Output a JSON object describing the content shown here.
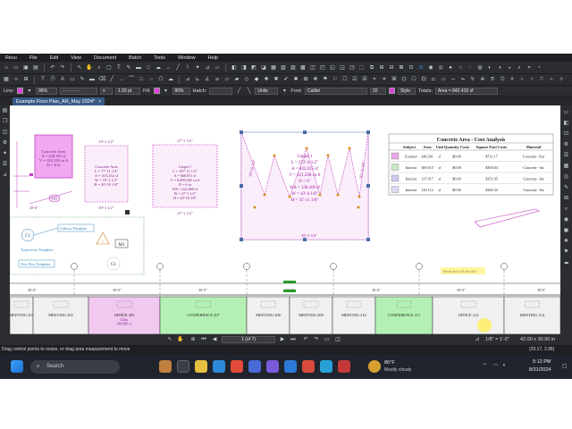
{
  "menu": [
    "Revu",
    "File",
    "Edit",
    "View",
    "Document",
    "Batch",
    "Tools",
    "Window",
    "Help"
  ],
  "props": {
    "line_label": "Line:",
    "opacity1": "96%",
    "thickness": "1.00 pt",
    "fill_label": "Fill:",
    "opacity2": "80%",
    "hatch_label": "Hatch:",
    "units": "Units",
    "font_label": "Font:",
    "font_value": "Calibri",
    "font_size": "20",
    "style": "Style",
    "totals_label": "Totals:",
    "totals_value": "Area = 842.416 sf"
  },
  "tab": {
    "name": "Example Floor Plan_AR_May 2024*",
    "close": "×"
  },
  "table": {
    "title": "Concrete Area - Cost Analysis",
    "headers": [
      "Subject",
      "Area",
      "Unit",
      "Quantity Costs",
      "Square Foot Costs",
      "Material"
    ],
    "rows": [
      [
        "Exterior",
        "240.301",
        "sf",
        "$0.00",
        "$721.17",
        "Concrete - Ext",
        "#e8a8e8"
      ],
      [
        "Interior",
        "300.015",
        "sf",
        "$0.00",
        "$300.04",
        "Concrete - Int",
        "#c8e8c8"
      ],
      [
        "Interior",
        "117.017",
        "sf",
        "$0.00",
        "$351.05",
        "Concrete - Int",
        "#cfc8f0"
      ],
      [
        "Interior",
        "120.112",
        "sf",
        "$0.00",
        "$360.34",
        "Concrete - Int",
        "#d8d8f0"
      ]
    ]
  },
  "markups": {
    "concrete_area_1": [
      "Concrete Area",
      "A = 240.301 sf",
      "V = 120.150 cu ft",
      "D = 6 in"
    ],
    "concrete_area_2": [
      "Concrete Area",
      "L = 77'-11 1/4\"",
      "A = 315.252 sf",
      "W = 19'-1 1/2\"",
      "H = 20'-10 1/8\""
    ],
    "dim_2_top": "19'-1 1/2\"",
    "dim_2_bottom": "19'-1 1/2\"",
    "carpet_1": [
      "Carpet 1",
      "L = 107'-11 1/4\"",
      "A = 668.051 sf",
      "V = 8.009.945 cu ft",
      "D = 6 in",
      "WA = 622.000 sf",
      "W = 27'-1 1/2\"",
      "H = 20'-10 1/8\""
    ],
    "dim_3_top": "27'-1 1/2\"",
    "dim_3_bottom": "27'-1 1/2\"",
    "carpet_2": [
      "Carpet 1",
      "L = 272'-4 1/2\"",
      "A = 842.415 sf",
      "V = 421.208 cu ft",
      "D = 6\"",
      "WA = 136.189 sf",
      "W = 43'-4 1/8\"",
      "H = 35'-11 3/8\""
    ],
    "dim_carpet_bottom": "39'-3 3/4\"",
    "dim_left": "20'-10 1/8\"",
    "dim_right": "20'-10 1/8\"",
    "badge_c1": "C1",
    "badge_c1b": "C1",
    "badge_m1": "M1",
    "calloutn_templ": "Callout Template",
    "typewriter": "Typewriter Template",
    "textbox": "Text Box Template",
    "note": "Head and sill details?",
    "small_value": "0.41",
    "dim_small": "20'-0\""
  },
  "rooms": [
    {
      "label": "MEETING 201",
      "sub": ""
    },
    {
      "label": "MEETING 203",
      "sub": ""
    },
    {
      "label": "OFFICE 205",
      "sub": "Glass\n269.965 sf"
    },
    {
      "label": "CONFERENCE 207",
      "sub": ""
    },
    {
      "label": "MEETING 208",
      "sub": ""
    },
    {
      "label": "MEETING 209",
      "sub": ""
    },
    {
      "label": "MEETING 210",
      "sub": ""
    },
    {
      "label": "CONFERENCE 211",
      "sub": ""
    },
    {
      "label": "OFFICE 212",
      "sub": ""
    },
    {
      "label": "MEETING 214",
      "sub": ""
    }
  ],
  "grid_dims": [
    "30'-0\"",
    "30'-0\"",
    "30'-0\"",
    "30'-0\"",
    "30'-0\"",
    "30'-0\"",
    "30'-0\""
  ],
  "status": {
    "page": "1 (of 7)",
    "scale": "1/8\" = 1'-0\"",
    "size": "42.00 x 30.00 in",
    "coords": "(20.17, 2.96)"
  },
  "hint": "Drag control points to resize, or drag area measurement to move",
  "taskbar": {
    "search": "Search",
    "weather_temp": "86°F",
    "weather_desc": "Mostly cloudy",
    "time": "5:12 PM",
    "date": "8/31/2024"
  }
}
